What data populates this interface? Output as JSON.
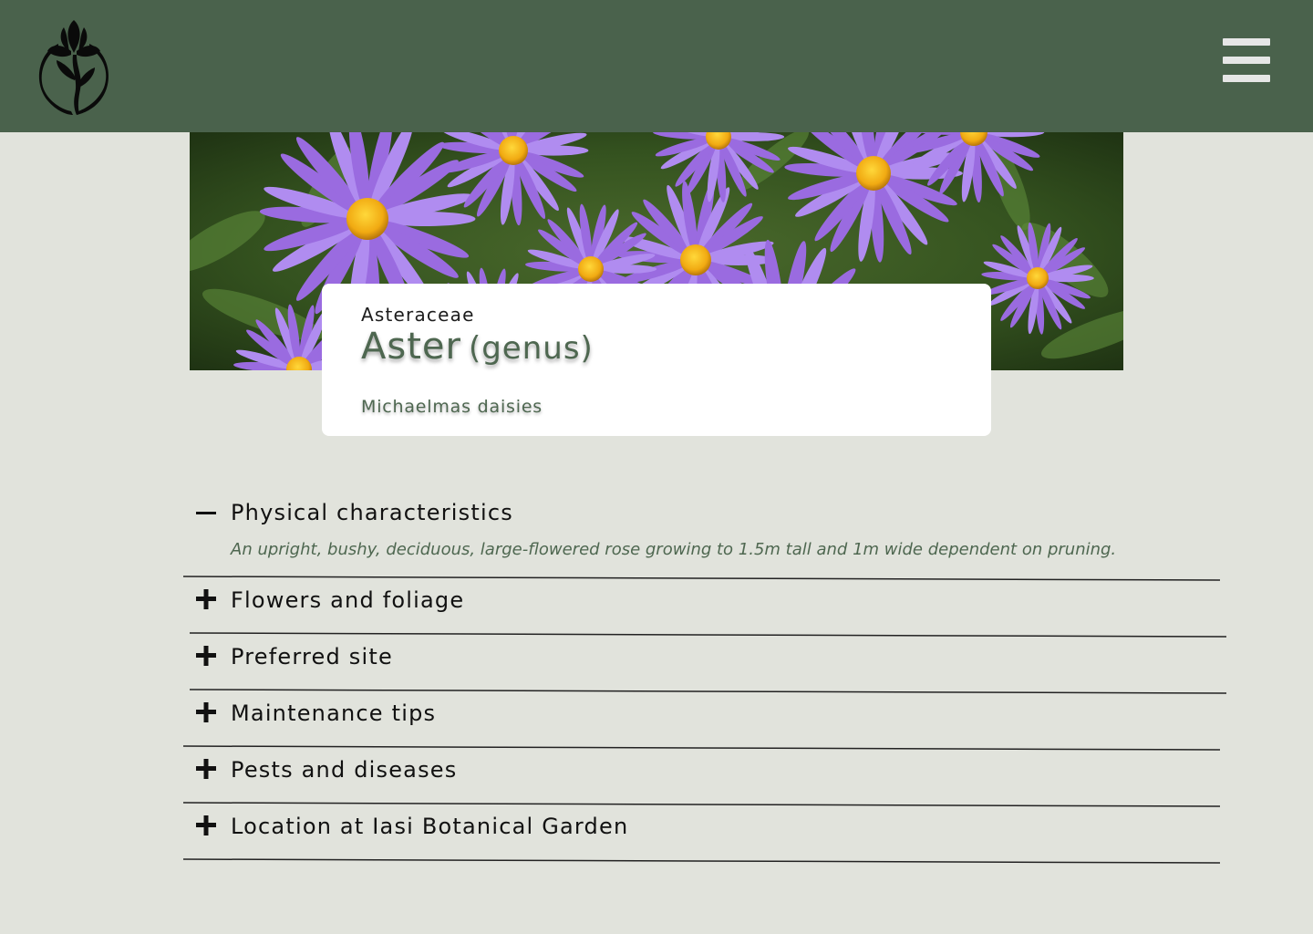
{
  "header": {
    "logo_icon": "flower-logo-icon",
    "menu_icon": "hamburger-menu-icon",
    "background": "#4a624c"
  },
  "hero": {
    "image": "purple aster flowers with yellow centers"
  },
  "plant": {
    "family": "Asteraceae",
    "genus": "Aster",
    "rank": "(genus)",
    "common_name": "Michaelmas daisies"
  },
  "sections": [
    {
      "title": "Physical characteristics",
      "expanded": true,
      "icon": "minus-icon",
      "body": "An upright, bushy, deciduous, large-flowered rose growing to 1.5m tall and 1m wide dependent on pruning."
    },
    {
      "title": "Flowers and foliage",
      "expanded": false,
      "icon": "plus-icon"
    },
    {
      "title": "Preferred site",
      "expanded": false,
      "icon": "plus-icon"
    },
    {
      "title": "Maintenance tips",
      "expanded": false,
      "icon": "plus-icon"
    },
    {
      "title": "Pests and diseases",
      "expanded": false,
      "icon": "plus-icon"
    },
    {
      "title": "Location at Iasi Botanical Garden",
      "expanded": false,
      "icon": "plus-icon"
    }
  ],
  "colors": {
    "page_bg": "#e1e3dc",
    "accent_green": "#4e6750",
    "petal": "#9a6be0",
    "flower_center": "#f2b418"
  }
}
